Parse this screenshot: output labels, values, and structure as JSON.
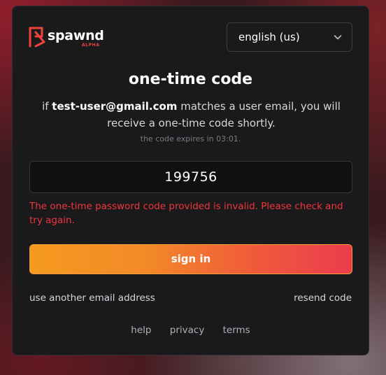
{
  "brand": {
    "name": "spawnd",
    "tag": "ALPHA",
    "accent": "#f0423c"
  },
  "language": {
    "selected": "english (us)"
  },
  "title": "one-time code",
  "message": {
    "prefix": "if",
    "email": "test-user@gmail.com",
    "suffix": "matches a user email, you will receive a one-time code shortly."
  },
  "expires": "the code expires in 03:01.",
  "code_field": {
    "value": "199756"
  },
  "error": "The one-time password code provided is invalid. Please check and try again.",
  "signin_label": "sign in",
  "links": {
    "other_email": "use another email address",
    "resend": "resend code"
  },
  "footer": {
    "help": "help",
    "privacy": "privacy",
    "terms": "terms"
  },
  "colors": {
    "error": "#f0363a",
    "button_start": "#f59a1f",
    "button_end": "#eb3c4e"
  }
}
